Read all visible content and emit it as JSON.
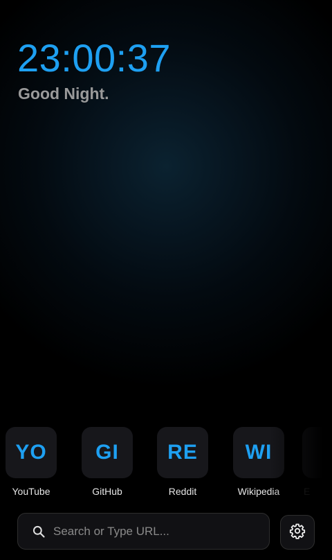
{
  "clock": {
    "time": "23:00:37"
  },
  "greeting": {
    "text": "Good Night."
  },
  "shortcuts": [
    {
      "abbr": "YO",
      "label": "YouTube"
    },
    {
      "abbr": "GI",
      "label": "GitHub"
    },
    {
      "abbr": "RE",
      "label": "Reddit"
    },
    {
      "abbr": "WI",
      "label": "Wikipedia"
    },
    {
      "abbr": "",
      "label": "E"
    }
  ],
  "search": {
    "placeholder": "Search or Type URL...",
    "value": "",
    "icon": "search-icon"
  },
  "settings": {
    "icon": "gear-icon"
  },
  "colors": {
    "accent": "#1ea0f2",
    "greeting": "#9a9a9a",
    "tile_bg": "#17171b"
  }
}
